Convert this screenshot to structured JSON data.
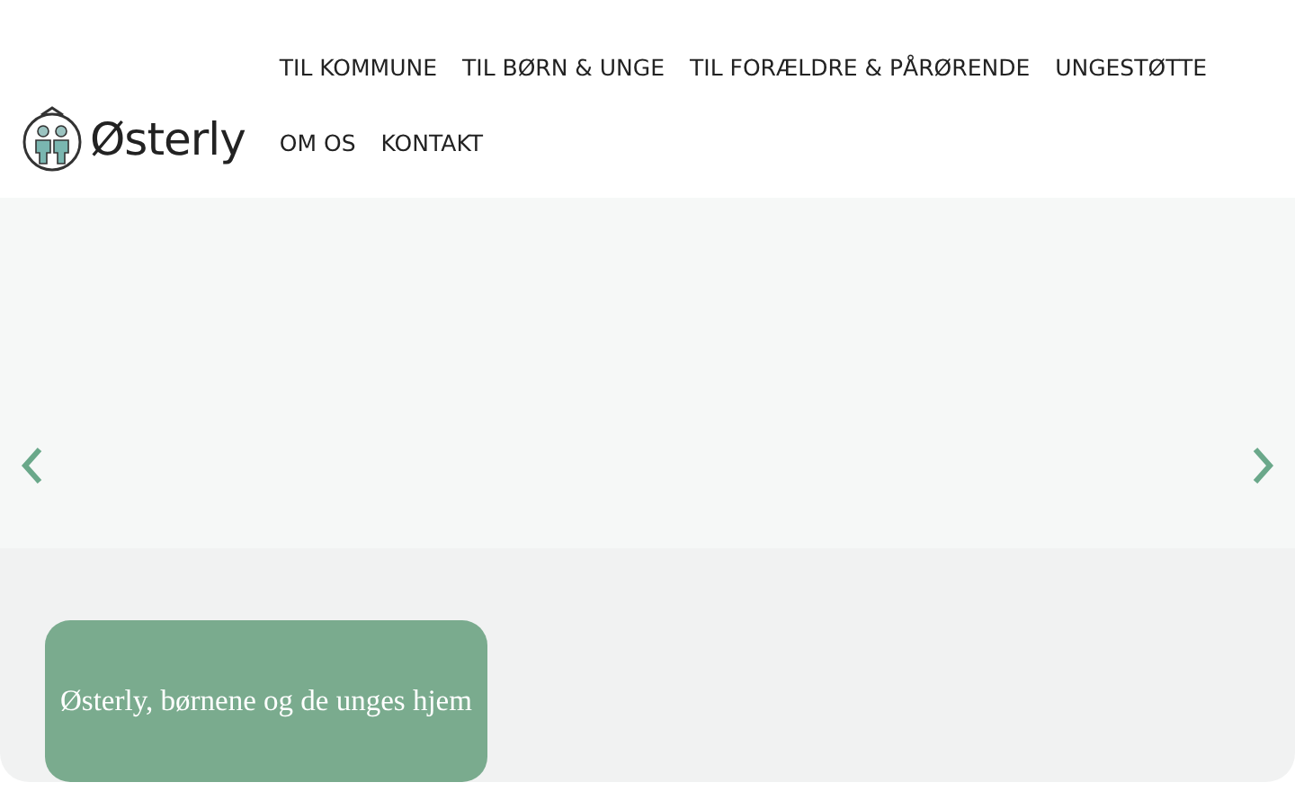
{
  "header": {
    "logo": "Østerly",
    "nav": [
      {
        "label": "TIL KOMMUNE"
      },
      {
        "label": "TIL BØRN & UNGE"
      },
      {
        "label": "TIL FORÆLDRE & PÅRØRENDE"
      },
      {
        "label": "UNGESTØTTE"
      },
      {
        "label": "OM OS"
      },
      {
        "label": "KONTAKT"
      }
    ]
  },
  "hero": {
    "caption": "Østerly, børnene og de unges hjem"
  }
}
